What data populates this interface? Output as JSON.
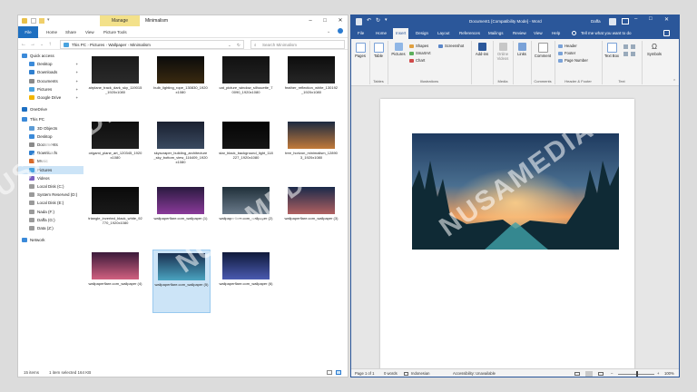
{
  "explorer": {
    "manage_tab": "Manage",
    "title": "Minimalism",
    "tabs": [
      "File",
      "Home",
      "Share",
      "View",
      "Picture Tools"
    ],
    "breadcrumb": [
      "This PC",
      "Pictures",
      "Wallpaper",
      "Minimalism"
    ],
    "search_placeholder": "Search Minimalism",
    "nav": [
      {
        "label": "Quick access",
        "color": "#3b8ad9",
        "level": 0
      },
      {
        "label": "Desktop",
        "color": "#3b8ad9",
        "level": 1,
        "pinned": true
      },
      {
        "label": "Downloads",
        "color": "#2f7fcf",
        "level": 1,
        "pinned": true
      },
      {
        "label": "Documents",
        "color": "#8a8a8a",
        "level": 1,
        "pinned": true
      },
      {
        "label": "Pictures",
        "color": "#4aa3df",
        "level": 1,
        "pinned": true
      },
      {
        "label": "Google Drive",
        "color": "#f2b500",
        "level": 1,
        "pinned": true
      },
      {
        "label": "OneDrive",
        "color": "#1d6fc2",
        "level": 0
      },
      {
        "label": "This PC",
        "color": "#3b8ad9",
        "level": 0
      },
      {
        "label": "3D Objects",
        "color": "#5b9bd5",
        "level": 1
      },
      {
        "label": "Desktop",
        "color": "#3b8ad9",
        "level": 1
      },
      {
        "label": "Documents",
        "color": "#8a8a8a",
        "level": 1
      },
      {
        "label": "Downloads",
        "color": "#2f7fcf",
        "level": 1
      },
      {
        "label": "Music",
        "color": "#d86a2a",
        "level": 1
      },
      {
        "label": "Pictures",
        "color": "#4aa3df",
        "level": 1,
        "selected": true
      },
      {
        "label": "Videos",
        "color": "#7a5fc0",
        "level": 1
      },
      {
        "label": "Local Disk (C:)",
        "color": "#9a9a9a",
        "level": 1
      },
      {
        "label": "System Reserved (D:)",
        "color": "#9a9a9a",
        "level": 1
      },
      {
        "label": "Local Disk (E:)",
        "color": "#9a9a9a",
        "level": 1
      },
      {
        "label": "Nada (F:)",
        "color": "#9a9a9a",
        "level": 1
      },
      {
        "label": "Daffa (G:)",
        "color": "#9a9a9a",
        "level": 1
      },
      {
        "label": "Data (Z:)",
        "color": "#9a9a9a",
        "level": 1
      },
      {
        "label": "Network",
        "color": "#3b8ad9",
        "level": 0
      }
    ],
    "files": [
      {
        "name": "airplane_track_dark_sky_119015_1920x1080",
        "c1": "#1a1a1a",
        "c2": "#2a2a2a"
      },
      {
        "name": "bulb_lighting_rope_130830_1920x1080",
        "c1": "#0b0b0b",
        "c2": "#3a2a10"
      },
      {
        "name": "cat_picture_window_silhouette_70090_1920x1080",
        "c1": "#111111",
        "c2": "#222222"
      },
      {
        "name": "feather_reflection_white_130192_1920x1080",
        "c1": "#0d0d0d",
        "c2": "#262626"
      },
      {
        "name": "origami_plane_art_120345_1920x1080",
        "c1": "#0f0f0f",
        "c2": "#1f1f1f"
      },
      {
        "name": "skyscraper_building_architecture_sky_bottom_view_116409_1920x1080",
        "c1": "#1a2030",
        "c2": "#3a4a60"
      },
      {
        "name": "star_black_background_light_118227_1920x1080",
        "c1": "#050505",
        "c2": "#151515"
      },
      {
        "name": "tree_horizon_minimalism_128903_1920x1080",
        "c1": "#1b2a40",
        "c2": "#c27a3a"
      },
      {
        "name": "triangle_inverted_black_white_92770_1920x1080",
        "c1": "#0a0a0a",
        "c2": "#1a1a1a"
      },
      {
        "name": "wallpaperflare.com_wallpaper (1)",
        "c1": "#2a1a40",
        "c2": "#8a3a9a"
      },
      {
        "name": "wallpaperflare.com_wallpaper (2)",
        "c1": "#20303a",
        "c2": "#6a7a8a"
      },
      {
        "name": "wallpaperflare.com_wallpaper (3)",
        "c1": "#1a2a4a",
        "c2": "#b06060"
      },
      {
        "name": "wallpaperflare.com_wallpaper (4)",
        "c1": "#3a1a3a",
        "c2": "#d06080"
      },
      {
        "name": "wallpaperflare.com_wallpaper (5)",
        "c1": "#1a3050",
        "c2": "#4aa3c0",
        "selected": true
      },
      {
        "name": "wallpaperflare.com_wallpaper (6)",
        "c1": "#101a3a",
        "c2": "#4a5ab0"
      }
    ],
    "status_count": "15 items",
    "status_selected": "1 item selected  164 KB"
  },
  "word": {
    "title": "Document1 [Compatibility Mode]  -  Word",
    "user": "Daffa",
    "tabs": [
      "File",
      "Home",
      "Insert",
      "Design",
      "Layout",
      "References",
      "Mailings",
      "Review",
      "View",
      "Help"
    ],
    "active_tab": "Insert",
    "tell_me": "Tell me what you want to do",
    "ribbon": {
      "pages": "Pages",
      "table": "Table",
      "pictures": "Pictures",
      "shapes": "Shapes",
      "smartart": "SmartArt",
      "chart": "Chart",
      "screenshot": "Screenshot",
      "addins": "Add-ins",
      "online_video": "Online Videos",
      "links": "Links",
      "comment": "Comment",
      "header": "Header",
      "footer": "Footer",
      "page_number": "Page Number",
      "text_box": "Text Box",
      "symbols": "Symbols",
      "groups": [
        "Tables",
        "Illustrations",
        "Media",
        "Comments",
        "Header & Footer",
        "Text"
      ]
    },
    "status": {
      "page": "Page 1 of 1",
      "words": "0 words",
      "language": "Indonesian",
      "accessibility": "Accessibility: Unavailable",
      "zoom": "100%"
    }
  },
  "watermark": "NUSAMEDIA"
}
